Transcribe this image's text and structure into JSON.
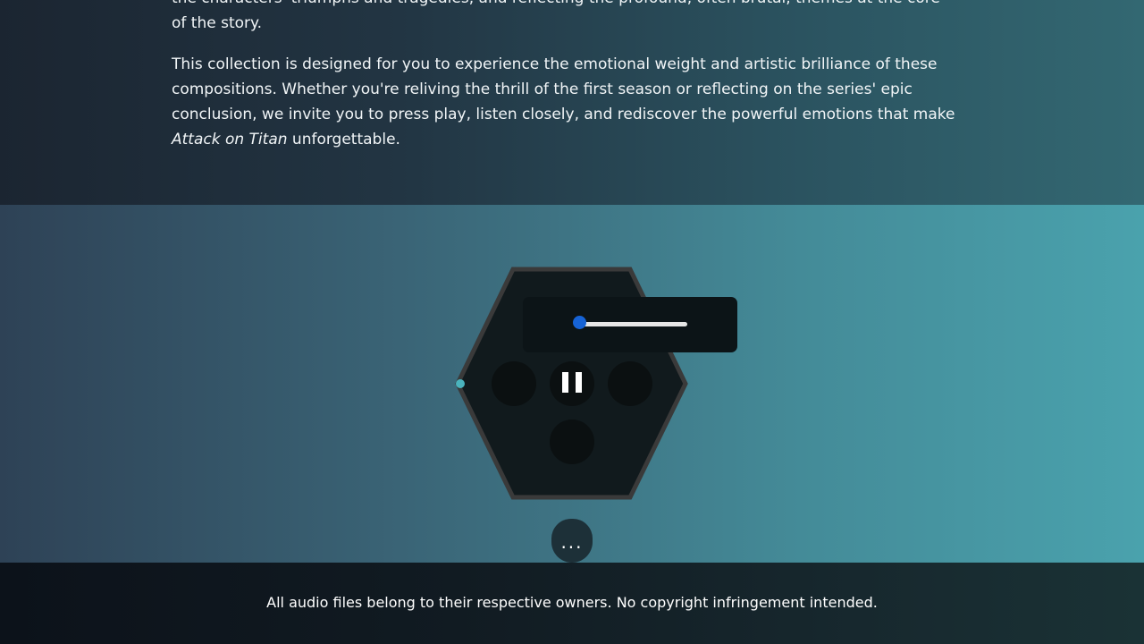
{
  "intro": {
    "paragraph1_line1": "the characters' triumphs and tragedies, and reflecting the profound, often brutal, themes at the core",
    "paragraph1_line2": "of the story.",
    "paragraph2_before_title": "This collection is designed for you to experience the emotional weight and artistic brilliance of these compositions. Whether you're reliving the thrill of the first season or reflecting on the series' epic conclusion, we invite you to press play, listen closely, and rediscover the powerful emotions that make ",
    "paragraph2_title": "Attack on Titan",
    "paragraph2_after_title": " unforgettable."
  },
  "player": {
    "volume": 0,
    "play_state": "playing",
    "pause_icon": "pause-icon",
    "more_label": "..."
  },
  "footer": {
    "disclaimer": "All audio files belong to their respective owners. No copyright infringement intended."
  },
  "colors": {
    "volume_thumb": "#1663d6",
    "edge_dot": "#4ab3bd",
    "hexagon_fill": "#111a1d",
    "hexagon_border": "#3a3a3a"
  }
}
